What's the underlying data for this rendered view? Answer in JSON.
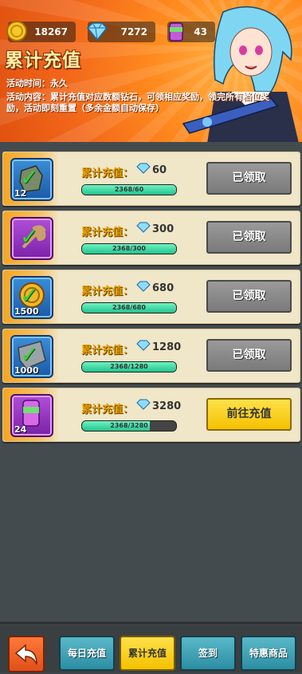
{
  "resources": [
    {
      "icon": "coin-icon",
      "value": "18267"
    },
    {
      "icon": "diamond-icon",
      "value": "7272"
    },
    {
      "icon": "energy-can-icon",
      "value": "43"
    }
  ],
  "header": {
    "title": "累计充值",
    "time": "活动时间：永久",
    "desc": "活动内容：累计充值对应数额钻石，可领相应奖励，领完所有档位奖励，活动即刻重置（多余金额自动保存）"
  },
  "rewards": [
    {
      "reward_icon": "stone-icon",
      "qty": "12",
      "label": "累计充值：",
      "amount": "60",
      "progress": "2368/60",
      "progress_ratio": 1.0,
      "button": "已领取",
      "claimed": true
    },
    {
      "reward_icon": "wrench-icon",
      "qty": "",
      "label": "累计充值：",
      "amount": "300",
      "progress": "2368/300",
      "progress_ratio": 1.0,
      "button": "已领取",
      "claimed": true
    },
    {
      "reward_icon": "gold-coin-icon",
      "qty": "1500",
      "label": "累计充值：",
      "amount": "680",
      "progress": "2368/680",
      "progress_ratio": 1.0,
      "button": "已领取",
      "claimed": true
    },
    {
      "reward_icon": "scrap-metal-icon",
      "qty": "1000",
      "label": "累计充值：",
      "amount": "1280",
      "progress": "2368/1280",
      "progress_ratio": 1.0,
      "button": "已领取",
      "claimed": true
    },
    {
      "reward_icon": "energy-can-icon",
      "qty": "24",
      "label": "累计充值：",
      "amount": "3280",
      "progress": "2368/3280",
      "progress_ratio": 0.72,
      "button": "前往充值",
      "claimed": false
    }
  ],
  "nav": {
    "back_icon": "back-arrow-icon",
    "items": [
      {
        "label": "每日充值",
        "active": false
      },
      {
        "label": "累计充值",
        "active": true
      },
      {
        "label": "签到",
        "active": false
      },
      {
        "label": "特惠商品",
        "active": false
      }
    ]
  },
  "colors": {
    "accent": "#f5c100",
    "banner": "#f2661a",
    "progress": "#22c48d"
  }
}
